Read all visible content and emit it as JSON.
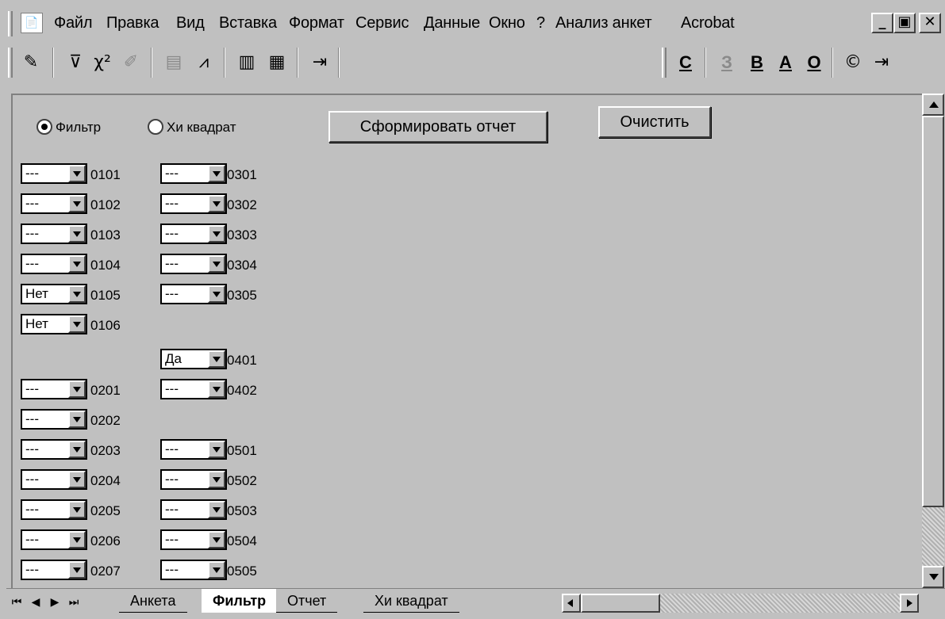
{
  "menubar": {
    "items": [
      {
        "label": "Файл"
      },
      {
        "label": "Правка"
      },
      {
        "label": "Вид"
      },
      {
        "label": "Вставка"
      },
      {
        "label": "Формат"
      },
      {
        "label": "Сервис"
      },
      {
        "label": "Данные"
      },
      {
        "label": "Окно"
      },
      {
        "label": "?"
      },
      {
        "label": "Анализ анкет"
      },
      {
        "label": "Acrobat"
      }
    ],
    "window_controls": {
      "minimize": "_",
      "restore": "▣",
      "close": "✕"
    }
  },
  "toolbar": {
    "letters": [
      {
        "label": "С",
        "enabled": true
      },
      {
        "label": "З",
        "enabled": false
      },
      {
        "label": "В",
        "enabled": true
      },
      {
        "label": "А",
        "enabled": true
      },
      {
        "label": "О",
        "enabled": true
      }
    ]
  },
  "form": {
    "radio_filter": "Фильтр",
    "radio_chi": "Хи квадрат",
    "selected": "filter",
    "btn_report": "Сформировать отчет",
    "btn_clear": "Очистить"
  },
  "combos": {
    "col1": [
      {
        "value": "---",
        "code": "0101"
      },
      {
        "value": "---",
        "code": "0102"
      },
      {
        "value": "---",
        "code": "0103"
      },
      {
        "value": "---",
        "code": "0104"
      },
      {
        "value": "Нет",
        "code": "0105"
      },
      {
        "value": "Нет",
        "code": "0106"
      },
      {
        "value": "---",
        "code": "0201"
      },
      {
        "value": "---",
        "code": "0202"
      },
      {
        "value": "---",
        "code": "0203"
      },
      {
        "value": "---",
        "code": "0204"
      },
      {
        "value": "---",
        "code": "0205"
      },
      {
        "value": "---",
        "code": "0206"
      },
      {
        "value": "---",
        "code": "0207"
      }
    ],
    "col2": [
      {
        "value": "---",
        "code": "0301"
      },
      {
        "value": "---",
        "code": "0302"
      },
      {
        "value": "---",
        "code": "0303"
      },
      {
        "value": "---",
        "code": "0304"
      },
      {
        "value": "---",
        "code": "0305"
      },
      {
        "value": "Да",
        "code": "0401"
      },
      {
        "value": "---",
        "code": "0402"
      },
      {
        "value": "---",
        "code": "0501"
      },
      {
        "value": "---",
        "code": "0502"
      },
      {
        "value": "---",
        "code": "0503"
      },
      {
        "value": "---",
        "code": "0504"
      },
      {
        "value": "---",
        "code": "0505"
      }
    ]
  },
  "sheet_tabs": [
    {
      "label": "Анкета",
      "active": false
    },
    {
      "label": "Фильтр",
      "active": true
    },
    {
      "label": "Отчет",
      "active": false
    },
    {
      "label": "Хи квадрат",
      "active": false
    }
  ]
}
